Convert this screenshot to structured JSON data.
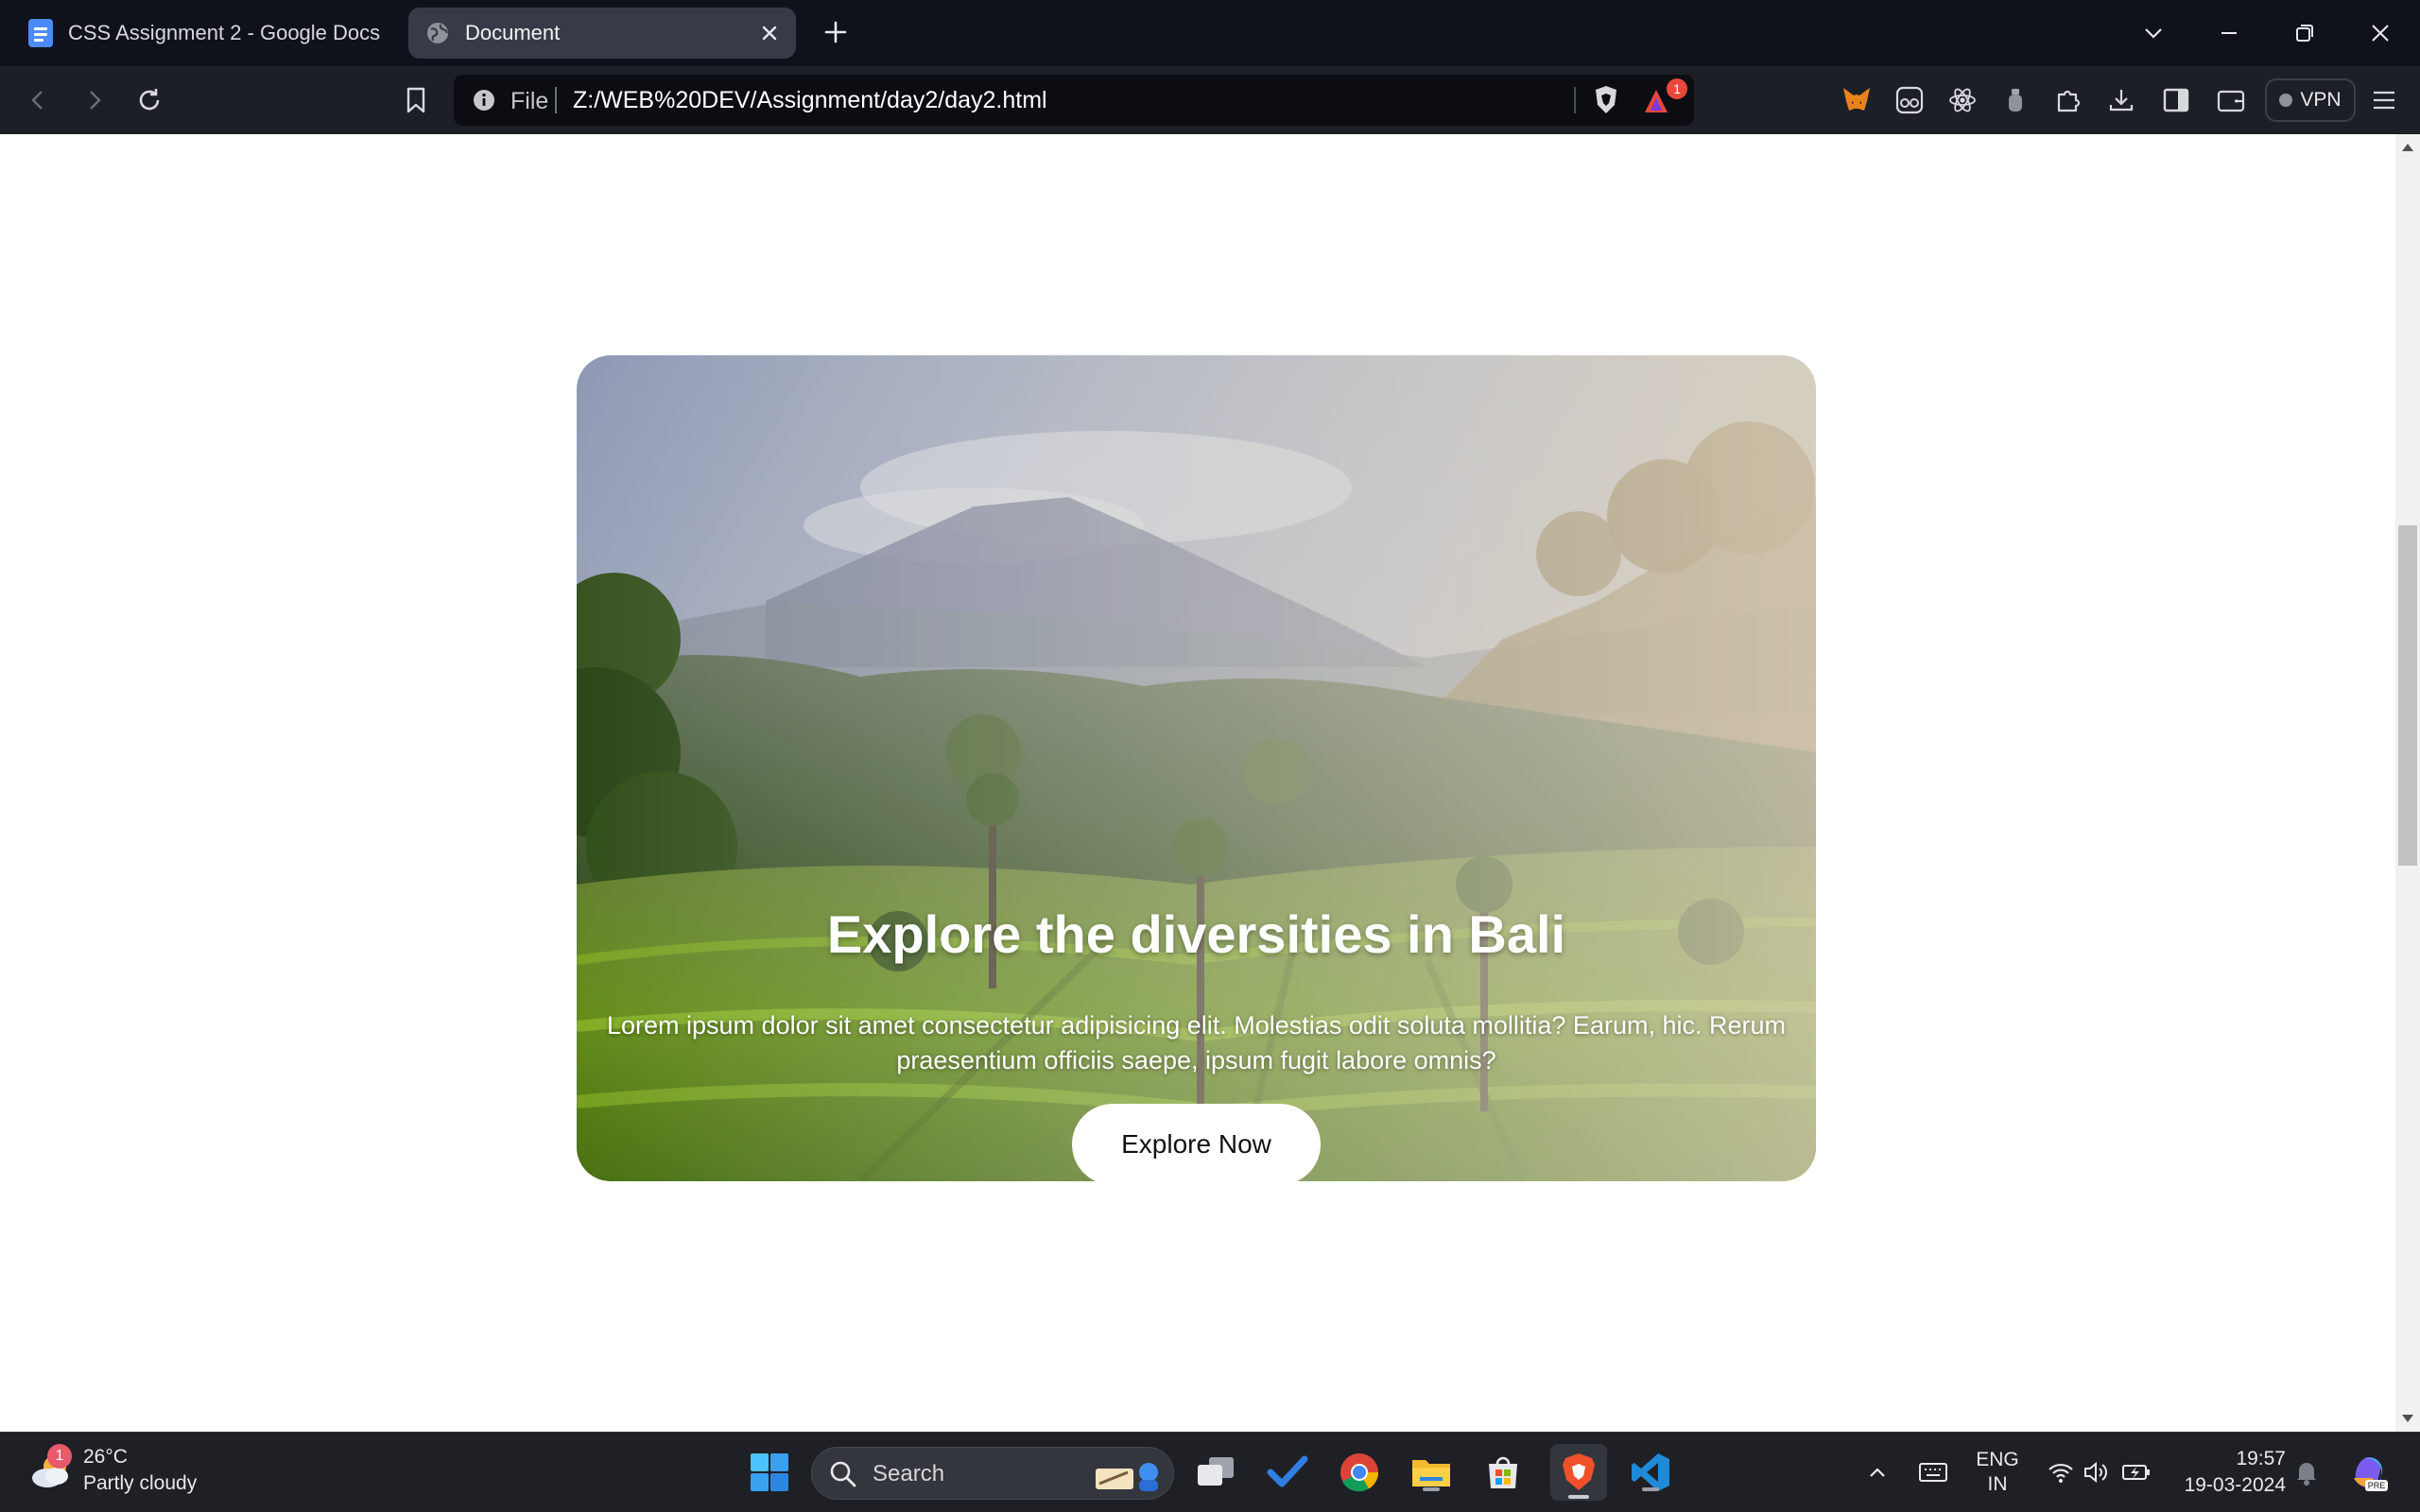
{
  "browser": {
    "tabs": [
      {
        "title": "CSS Assignment 2 - Google Docs",
        "active": false,
        "icon": "google-docs-icon"
      },
      {
        "title": "Document",
        "active": true,
        "icon": "globe-icon"
      }
    ],
    "address": {
      "scheme": "File",
      "url": "Z:/WEB%20DEV/Assignment/day2/day2.html"
    },
    "brave_rewards_badge": "1",
    "vpn_label": "VPN"
  },
  "page": {
    "hero": {
      "title": "Explore the diversities in Bali",
      "text": "Lorem ipsum dolor sit amet consectetur adipisicing elit. Molestias odit soluta mollitia? Earum, hic. Rerum praesentium officiis saepe, ipsum fugit labore omnis?",
      "button_label": "Explore Now"
    }
  },
  "taskbar": {
    "weather": {
      "temperature": "26°C",
      "condition": "Partly cloudy",
      "badge": "1"
    },
    "search_placeholder": "Search",
    "language": {
      "line1": "ENG",
      "line2": "IN"
    },
    "clock": {
      "time": "19:57",
      "date": "19-03-2024"
    }
  },
  "colors": {
    "tabstrip_bg": "#0f121a",
    "toolbar_bg": "#1c1f26",
    "taskbar_bg": "#1f2026",
    "hero_button_bg": "#ffffff"
  }
}
